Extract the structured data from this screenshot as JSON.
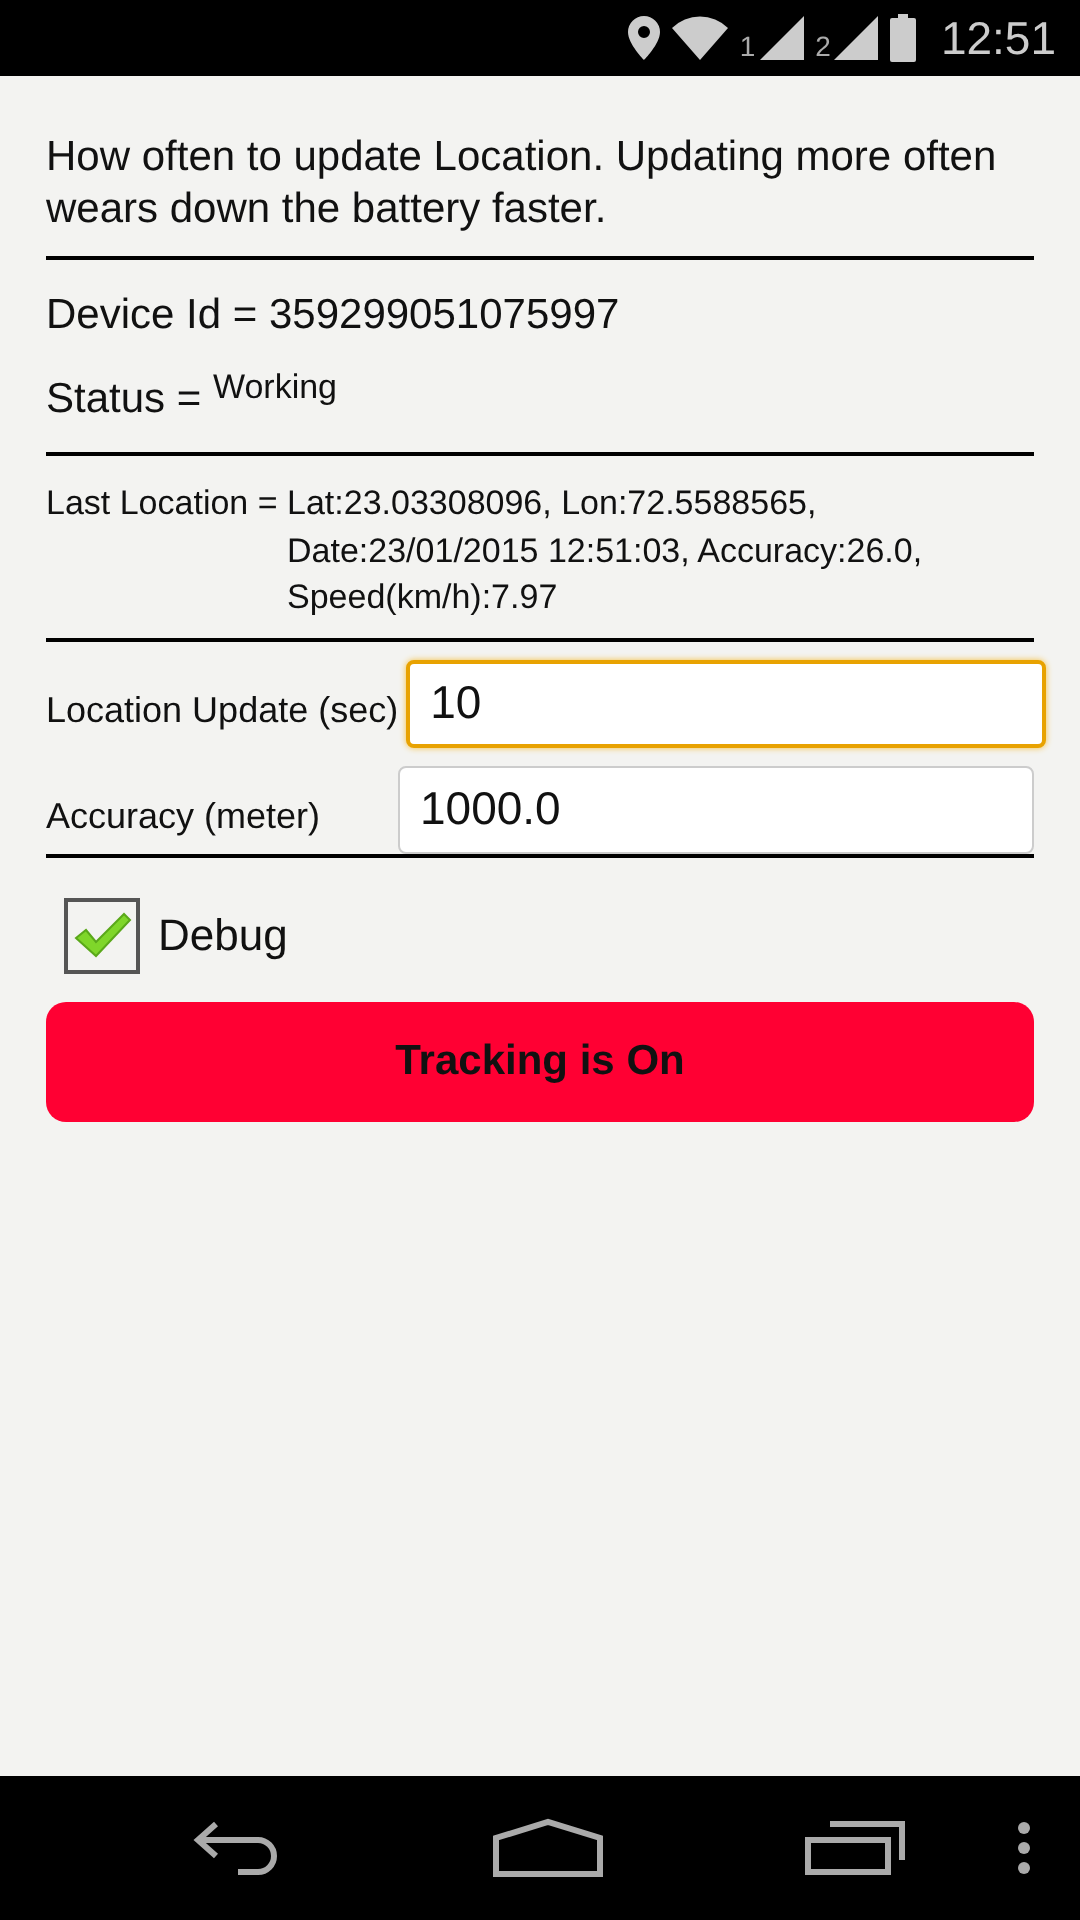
{
  "status_bar": {
    "sim_1": "1",
    "sim_2": "2",
    "time": "12:51"
  },
  "description": "How often to update Location. Updating more often wears down the battery faster.",
  "device": {
    "label": "Device Id = ",
    "value": "359299051075997"
  },
  "status": {
    "label": "Status = ",
    "value": "Working"
  },
  "last_location": {
    "label": "Last Location = ",
    "value": "Lat:23.03308096, Lon:72.5588565, Date:23/01/2015 12:51:03, Accuracy:26.0, Speed(km/h):7.97"
  },
  "fields": [
    {
      "label": "Location Update (sec)",
      "value": "10",
      "focused": true
    },
    {
      "label": "Accuracy (meter)",
      "value": "1000.0",
      "focused": false
    }
  ],
  "debug": {
    "label": "Debug",
    "checked": true
  },
  "tracking_button": {
    "label": "Tracking is On"
  }
}
